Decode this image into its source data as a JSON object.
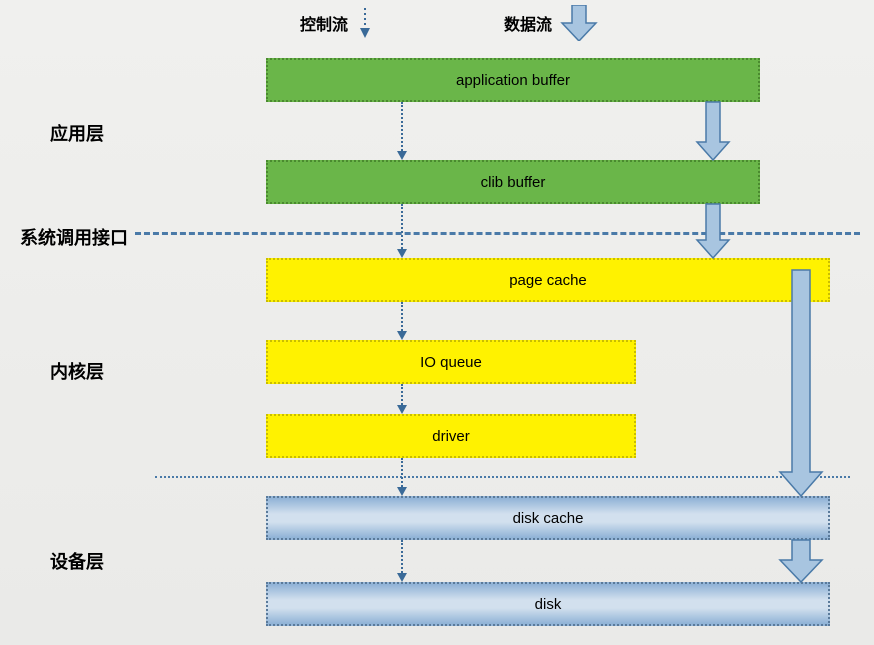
{
  "legend": {
    "control_flow": "控制流",
    "data_flow": "数据流"
  },
  "layers": {
    "app": "应用层",
    "syscall": "系统调用接口",
    "kernel": "内核层",
    "device": "设备层"
  },
  "boxes": {
    "app_buffer": "application buffer",
    "clib_buffer": "clib buffer",
    "page_cache": "page cache",
    "io_queue": "IO queue",
    "driver": "driver",
    "disk_cache": "disk cache",
    "disk": "disk"
  },
  "colors": {
    "green": "#6ab649",
    "yellow": "#fff200",
    "blue_arrow_fill": "#a8c5e0",
    "blue_arrow_stroke": "#4a7aa8",
    "thin_arrow": "#3a6a98"
  }
}
